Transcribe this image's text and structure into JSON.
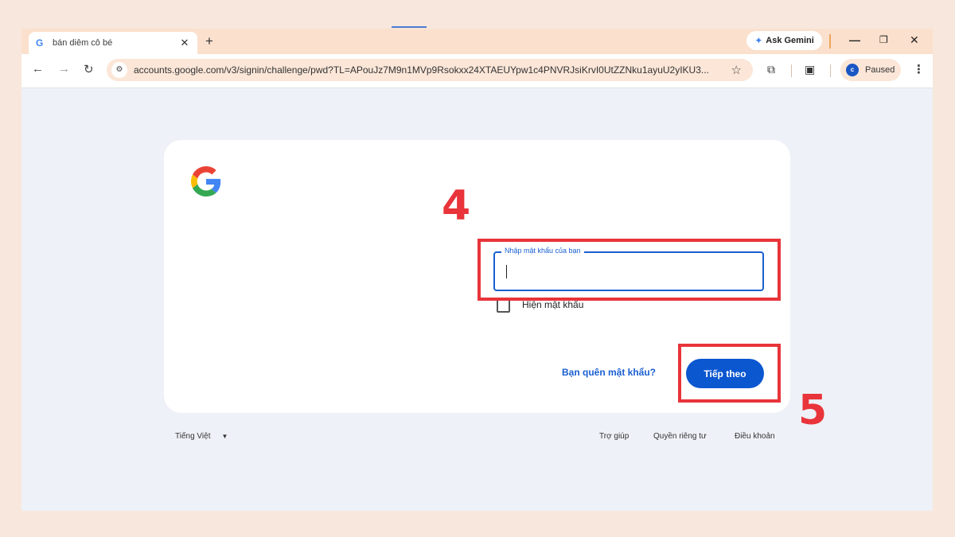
{
  "browser": {
    "tab_title": "bán diêm cô bé",
    "tab_favicon": "G",
    "new_tab_label": "+",
    "ask_gemini": "Ask Gemini",
    "url": "accounts.google.com/v3/signin/challenge/pwd?TL=APouJz7M9n1MVp9Rsokxx24XTAEUYpw1c4PNVRJsiKrvI0UtZZNku1ayuU2yIKU3...",
    "profile_initial": "c",
    "profile_status": "Paused",
    "window_controls": [
      "minimize-icon",
      "restore-icon",
      "close-icon"
    ]
  },
  "signin": {
    "password_label": "Nhập mật khẩu của bạn",
    "password_value": "",
    "show_password_label": "Hiện mật khẩu",
    "forgot_link": "Bạn quên mật khẩu?",
    "next_button": "Tiếp theo"
  },
  "footer": {
    "language": "Tiếng Việt",
    "help": "Trợ giúp",
    "privacy": "Quyền riêng tư",
    "terms": "Điều khoản"
  },
  "annotations": {
    "step_4": "4",
    "step_5": "5",
    "highlight_color": "#e8343a"
  },
  "colors": {
    "accent_blue": "#0b57d0",
    "page_bg": "#f8e7dc",
    "tabbar_bg": "#fbe0cd"
  }
}
